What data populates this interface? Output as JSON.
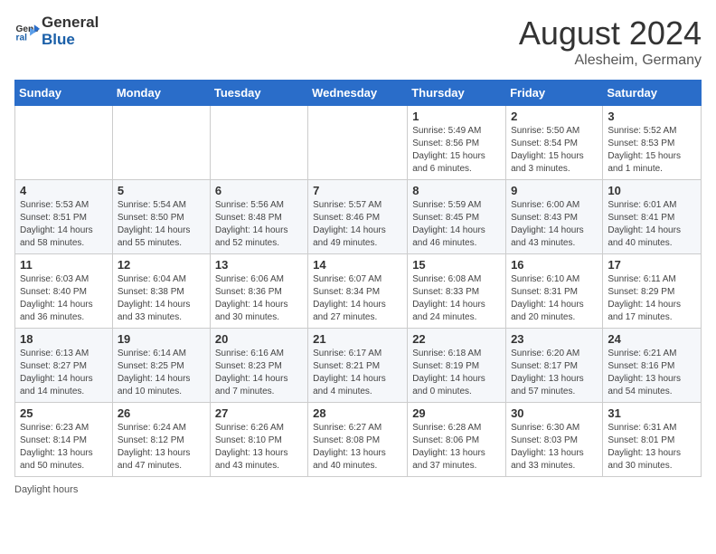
{
  "header": {
    "logo_line1": "General",
    "logo_line2": "Blue",
    "month_year": "August 2024",
    "location": "Alesheim, Germany"
  },
  "footer": {
    "note": "Daylight hours"
  },
  "days_of_week": [
    "Sunday",
    "Monday",
    "Tuesday",
    "Wednesday",
    "Thursday",
    "Friday",
    "Saturday"
  ],
  "weeks": [
    [
      {
        "day": "",
        "info": ""
      },
      {
        "day": "",
        "info": ""
      },
      {
        "day": "",
        "info": ""
      },
      {
        "day": "",
        "info": ""
      },
      {
        "day": "1",
        "info": "Sunrise: 5:49 AM\nSunset: 8:56 PM\nDaylight: 15 hours and 6 minutes."
      },
      {
        "day": "2",
        "info": "Sunrise: 5:50 AM\nSunset: 8:54 PM\nDaylight: 15 hours and 3 minutes."
      },
      {
        "day": "3",
        "info": "Sunrise: 5:52 AM\nSunset: 8:53 PM\nDaylight: 15 hours and 1 minute."
      }
    ],
    [
      {
        "day": "4",
        "info": "Sunrise: 5:53 AM\nSunset: 8:51 PM\nDaylight: 14 hours and 58 minutes."
      },
      {
        "day": "5",
        "info": "Sunrise: 5:54 AM\nSunset: 8:50 PM\nDaylight: 14 hours and 55 minutes."
      },
      {
        "day": "6",
        "info": "Sunrise: 5:56 AM\nSunset: 8:48 PM\nDaylight: 14 hours and 52 minutes."
      },
      {
        "day": "7",
        "info": "Sunrise: 5:57 AM\nSunset: 8:46 PM\nDaylight: 14 hours and 49 minutes."
      },
      {
        "day": "8",
        "info": "Sunrise: 5:59 AM\nSunset: 8:45 PM\nDaylight: 14 hours and 46 minutes."
      },
      {
        "day": "9",
        "info": "Sunrise: 6:00 AM\nSunset: 8:43 PM\nDaylight: 14 hours and 43 minutes."
      },
      {
        "day": "10",
        "info": "Sunrise: 6:01 AM\nSunset: 8:41 PM\nDaylight: 14 hours and 40 minutes."
      }
    ],
    [
      {
        "day": "11",
        "info": "Sunrise: 6:03 AM\nSunset: 8:40 PM\nDaylight: 14 hours and 36 minutes."
      },
      {
        "day": "12",
        "info": "Sunrise: 6:04 AM\nSunset: 8:38 PM\nDaylight: 14 hours and 33 minutes."
      },
      {
        "day": "13",
        "info": "Sunrise: 6:06 AM\nSunset: 8:36 PM\nDaylight: 14 hours and 30 minutes."
      },
      {
        "day": "14",
        "info": "Sunrise: 6:07 AM\nSunset: 8:34 PM\nDaylight: 14 hours and 27 minutes."
      },
      {
        "day": "15",
        "info": "Sunrise: 6:08 AM\nSunset: 8:33 PM\nDaylight: 14 hours and 24 minutes."
      },
      {
        "day": "16",
        "info": "Sunrise: 6:10 AM\nSunset: 8:31 PM\nDaylight: 14 hours and 20 minutes."
      },
      {
        "day": "17",
        "info": "Sunrise: 6:11 AM\nSunset: 8:29 PM\nDaylight: 14 hours and 17 minutes."
      }
    ],
    [
      {
        "day": "18",
        "info": "Sunrise: 6:13 AM\nSunset: 8:27 PM\nDaylight: 14 hours and 14 minutes."
      },
      {
        "day": "19",
        "info": "Sunrise: 6:14 AM\nSunset: 8:25 PM\nDaylight: 14 hours and 10 minutes."
      },
      {
        "day": "20",
        "info": "Sunrise: 6:16 AM\nSunset: 8:23 PM\nDaylight: 14 hours and 7 minutes."
      },
      {
        "day": "21",
        "info": "Sunrise: 6:17 AM\nSunset: 8:21 PM\nDaylight: 14 hours and 4 minutes."
      },
      {
        "day": "22",
        "info": "Sunrise: 6:18 AM\nSunset: 8:19 PM\nDaylight: 14 hours and 0 minutes."
      },
      {
        "day": "23",
        "info": "Sunrise: 6:20 AM\nSunset: 8:17 PM\nDaylight: 13 hours and 57 minutes."
      },
      {
        "day": "24",
        "info": "Sunrise: 6:21 AM\nSunset: 8:16 PM\nDaylight: 13 hours and 54 minutes."
      }
    ],
    [
      {
        "day": "25",
        "info": "Sunrise: 6:23 AM\nSunset: 8:14 PM\nDaylight: 13 hours and 50 minutes."
      },
      {
        "day": "26",
        "info": "Sunrise: 6:24 AM\nSunset: 8:12 PM\nDaylight: 13 hours and 47 minutes."
      },
      {
        "day": "27",
        "info": "Sunrise: 6:26 AM\nSunset: 8:10 PM\nDaylight: 13 hours and 43 minutes."
      },
      {
        "day": "28",
        "info": "Sunrise: 6:27 AM\nSunset: 8:08 PM\nDaylight: 13 hours and 40 minutes."
      },
      {
        "day": "29",
        "info": "Sunrise: 6:28 AM\nSunset: 8:06 PM\nDaylight: 13 hours and 37 minutes."
      },
      {
        "day": "30",
        "info": "Sunrise: 6:30 AM\nSunset: 8:03 PM\nDaylight: 13 hours and 33 minutes."
      },
      {
        "day": "31",
        "info": "Sunrise: 6:31 AM\nSunset: 8:01 PM\nDaylight: 13 hours and 30 minutes."
      }
    ]
  ]
}
